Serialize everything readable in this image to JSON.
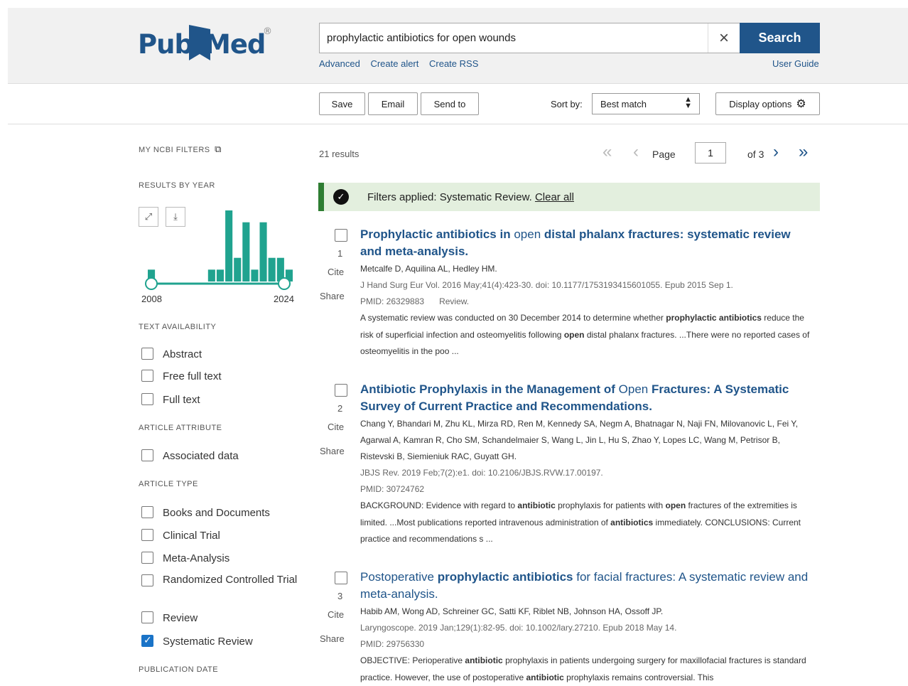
{
  "header": {
    "logo": {
      "part1": "Pub",
      "part2": "Med",
      "reg": "®"
    },
    "search": {
      "value": "prophylactic antibiotics for open wounds",
      "clear": "×",
      "button": "Search"
    },
    "links": {
      "advanced": "Advanced",
      "create_alert": "Create alert",
      "create_rss": "Create RSS",
      "user_guide": "User Guide"
    }
  },
  "toolbar": {
    "save": "Save",
    "email": "Email",
    "send_to": "Send to",
    "sort_label": "Sort by:",
    "sort_value": "Best match",
    "display_options": "Display options"
  },
  "sidebar": {
    "my_ncbi_filters": "MY NCBI FILTERS",
    "results_by_year": "RESULTS BY YEAR",
    "year_start": "2008",
    "year_end": "2024",
    "text_availability": "TEXT AVAILABILITY",
    "text_filters": [
      "Abstract",
      "Free full text",
      "Full text"
    ],
    "article_attribute": "ARTICLE ATTRIBUTE",
    "attribute_filters": [
      "Associated data"
    ],
    "article_type": "ARTICLE TYPE",
    "type_filters": [
      "Books and Documents",
      "Clinical Trial",
      "Meta-Analysis",
      "Randomized Controlled Trial",
      "Review",
      "Systematic Review"
    ],
    "type_checked": [
      false,
      false,
      false,
      false,
      false,
      true
    ],
    "publication_date": "PUBLICATION DATE",
    "year_counts": [
      1,
      0,
      0,
      0,
      0,
      0,
      0,
      1,
      1,
      6,
      2,
      5,
      1,
      5,
      2,
      2,
      1
    ]
  },
  "results_header": {
    "count": "21 results",
    "page_label": "Page",
    "page_value": "1",
    "of_pages": "of 3"
  },
  "filter_bar": {
    "text": "Filters applied: Systematic Review.",
    "clear": "Clear all"
  },
  "results": [
    {
      "num": "1",
      "cite": "Cite",
      "share": "Share",
      "title": [
        "Prophylactic antibiotics",
        " in ",
        "open",
        " distal phalanx fractures: systematic review and meta-analysis."
      ],
      "authors": "Metcalfe D, Aquilina AL, Hedley HM.",
      "citation": "J Hand Surg Eur Vol. 2016 May;41(4):423-30. doi: 10.1177/1753193415601055. Epub 2015 Sep 1.",
      "pmid": "PMID: 26329883",
      "type": "Review.",
      "snippet": [
        "A systematic review was conducted on 30 December 2014 to determine whether ",
        "prophylactic antibiotics",
        " reduce the risk of superficial infection and osteomyelitis following ",
        "open",
        " distal phalanx fractures. ...There were no reported cases of osteomyelitis in the poo ..."
      ]
    },
    {
      "num": "2",
      "cite": "Cite",
      "share": "Share",
      "title": [
        "Antibiotic",
        " Prophylaxis in the Management of ",
        "Open",
        " Fractures: A Systematic Survey of Current Practice and Recommendations."
      ],
      "authors": "Chang Y, Bhandari M, Zhu KL, Mirza RD, Ren M, Kennedy SA, Negm A, Bhatnagar N, Naji FN, Milovanovic L, Fei Y, Agarwal A, Kamran R, Cho SM, Schandelmaier S, Wang L, Jin L, Hu S, Zhao Y, Lopes LC, Wang M, Petrisor B, Ristevski B, Siemieniuk RAC, Guyatt GH.",
      "citation": "JBJS Rev. 2019 Feb;7(2):e1. doi: 10.2106/JBJS.RVW.17.00197.",
      "pmid": "PMID: 30724762",
      "type": "",
      "snippet": [
        "BACKGROUND: Evidence with regard to ",
        "antibiotic",
        " prophylaxis for patients with ",
        "open",
        " fractures of the extremities is limited. ...Most publications reported intravenous administration of ",
        "antibiotics",
        " immediately. CONCLUSIONS: Current practice and recommendations s ..."
      ]
    },
    {
      "num": "3",
      "cite": "Cite",
      "share": "Share",
      "title": [
        "Postoperative ",
        "prophylactic antibiotics",
        " for facial fractures: A systematic review and meta-analysis.",
        ""
      ],
      "authors": "Habib AM, Wong AD, Schreiner GC, Satti KF, Riblet NB, Johnson HA, Ossoff JP.",
      "citation": "Laryngoscope. 2019 Jan;129(1):82-95. doi: 10.1002/lary.27210. Epub 2018 May 14.",
      "pmid": "PMID: 29756330",
      "type": "",
      "snippet": [
        "OBJECTIVE: Perioperative ",
        "antibiotic",
        " prophylaxis in patients undergoing surgery for maxillofacial fractures is standard practice. However, the use of postoperative ",
        "antibiotic",
        " prophylaxis remains controversial. This",
        "",
        ""
      ]
    }
  ],
  "colors": {
    "brand": "#20558a",
    "bar": "#20a38f",
    "filter_bg": "#e3efde",
    "filter_accent": "#2e7d32",
    "check": "#1a73c7"
  }
}
